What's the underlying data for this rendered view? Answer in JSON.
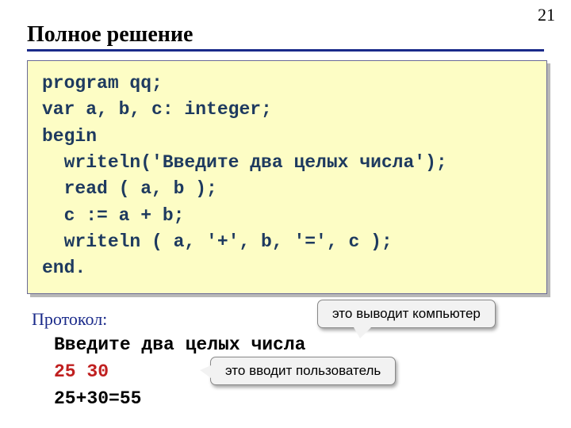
{
  "page_number": "21",
  "title": "Полное решение",
  "code": "program qq;\nvar a, b, c: integer;\nbegin\n  writeln('Введите два целых числа');\n  read ( a, b );\n  c := a + b;\n  writeln ( a, '+', b, '=', c );\nend.",
  "protocol_label": "Протокол:",
  "protocol": {
    "line1": "Введите два целых числа",
    "line2": "25 30",
    "line3": "25+30=55"
  },
  "callout_computer": "это выводит компьютер",
  "callout_user": "это вводит пользователь"
}
